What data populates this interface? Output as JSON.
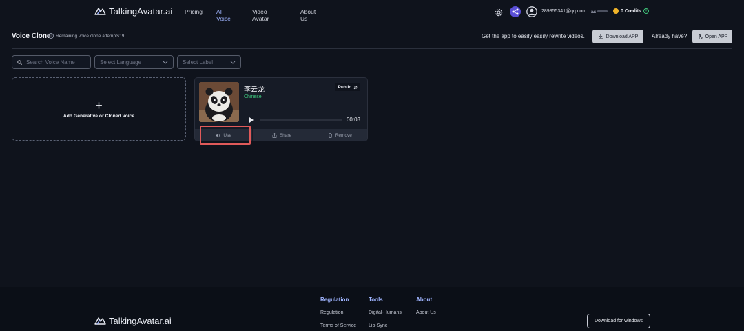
{
  "header": {
    "logo_text": "TalkingAvatar.ai",
    "nav": [
      "Pricing",
      "AI Voice",
      "Video Avatar",
      "About Us"
    ],
    "active_nav": "AI Voice",
    "email": "289855341@qq.com",
    "credits": "0 Credits"
  },
  "toolbar": {
    "title": "Voice Clone",
    "remaining": "Remaining voice clone attempts: 9",
    "get_app_text": "Get the app to easily easily rewrite videos.",
    "download_btn": "Download APP",
    "already_text": "Already have?",
    "open_btn": "Open APP"
  },
  "filters": {
    "search_placeholder": "Search Voice Name",
    "language_placeholder": "Select Language",
    "label_placeholder": "Select Label"
  },
  "add_card": {
    "label": "Add Generative or Cloned Voice"
  },
  "voice_card": {
    "name": "李云龙",
    "language": "Chinese",
    "visibility": "Public",
    "duration": "00:03",
    "progress_fraction": 0.0,
    "actions": [
      "Use",
      "Share",
      "Remove"
    ]
  },
  "footer": {
    "logo_text": "TalkingAvatar.ai",
    "cols": [
      {
        "title": "Regulation",
        "items": [
          "Regulation",
          "Terms of Service"
        ]
      },
      {
        "title": "Tools",
        "items": [
          "Digital-Humans",
          "Lip-Sync"
        ]
      },
      {
        "title": "About",
        "items": [
          "About Us"
        ]
      }
    ],
    "download_windows": "Download for windows"
  },
  "colors": {
    "accent": "#9fb4ff",
    "highlight": "#e05a5a",
    "language_green": "#3ec97e",
    "share_purple": "#5a4fd6"
  }
}
